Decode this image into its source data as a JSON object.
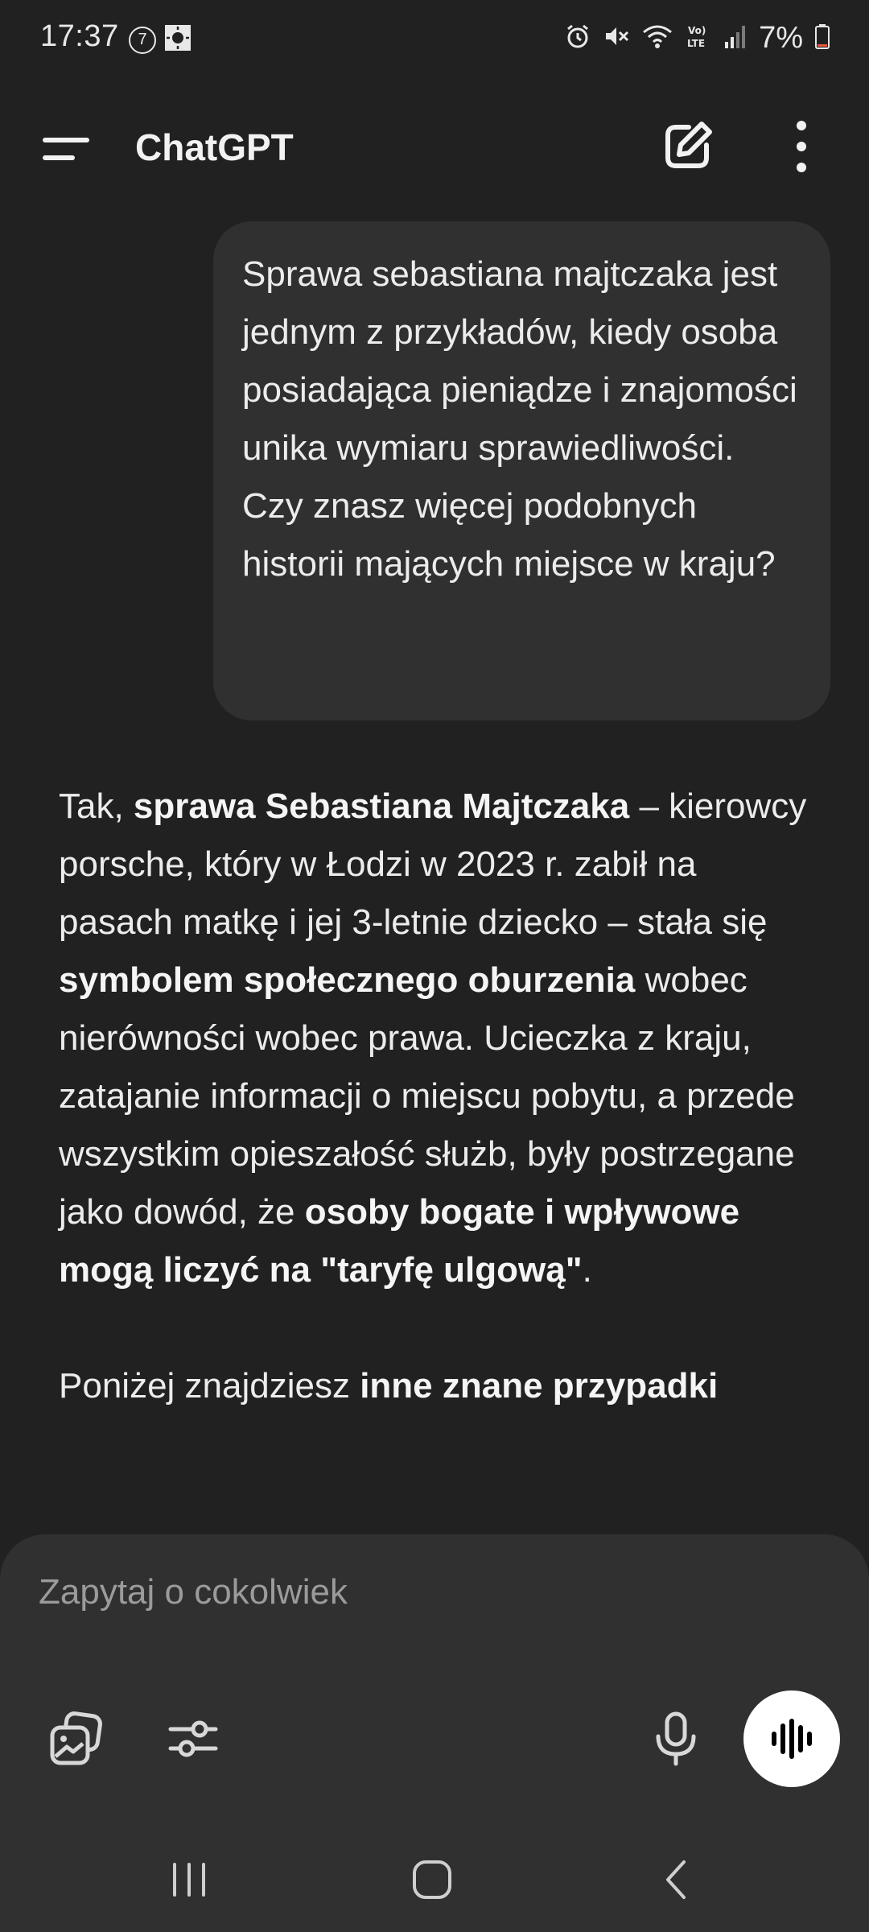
{
  "status_bar": {
    "time": "17:37",
    "notification_count": "7",
    "battery": "7%"
  },
  "app_bar": {
    "title": "ChatGPT"
  },
  "conversation": {
    "user_message": "Sprawa sebastiana majtczaka jest jednym z przykładów, kiedy osoba posiadająca pieniądze i znajomości unika wymiaru sprawiedliwości. Czy znasz więcej podobnych historii mających miejsce w kraju?",
    "assistant": {
      "p1": {
        "t1": "Tak, ",
        "b1": "sprawa Sebastiana Majtczaka",
        "t2": " – kierowcy porsche, który w Łodzi w 2023 r. zabił na pasach matkę i jej 3-letnie dziecko – stała się ",
        "b2": "symbolem społecznego oburzenia",
        "t3": " wobec nierówności wobec prawa. Ucieczka z kraju, zatajanie informacji o miejscu pobytu, a przede wszystkim opieszałość służb, były postrzegane jako dowód, że ",
        "b3": "osoby bogate i wpływowe mogą liczyć na \"taryfę ulgową\"",
        "t4": "."
      },
      "p2": {
        "t1": "Poniżej znajdziesz ",
        "b1": "inne znane przypadki"
      }
    }
  },
  "composer": {
    "placeholder": "Zapytaj o cokolwiek"
  },
  "colors": {
    "background": "#212121",
    "bubble": "#303030",
    "composer": "#303030",
    "text": "#ececec",
    "placeholder": "#9b9b9b",
    "voice_button": "#ffffff"
  },
  "icons": {
    "menu": "menu-icon",
    "new_chat": "edit-icon",
    "more": "more-vertical-icon",
    "attach": "image-attach-icon",
    "tools": "sliders-icon",
    "mic": "microphone-icon",
    "voice": "voice-waveform-icon"
  }
}
